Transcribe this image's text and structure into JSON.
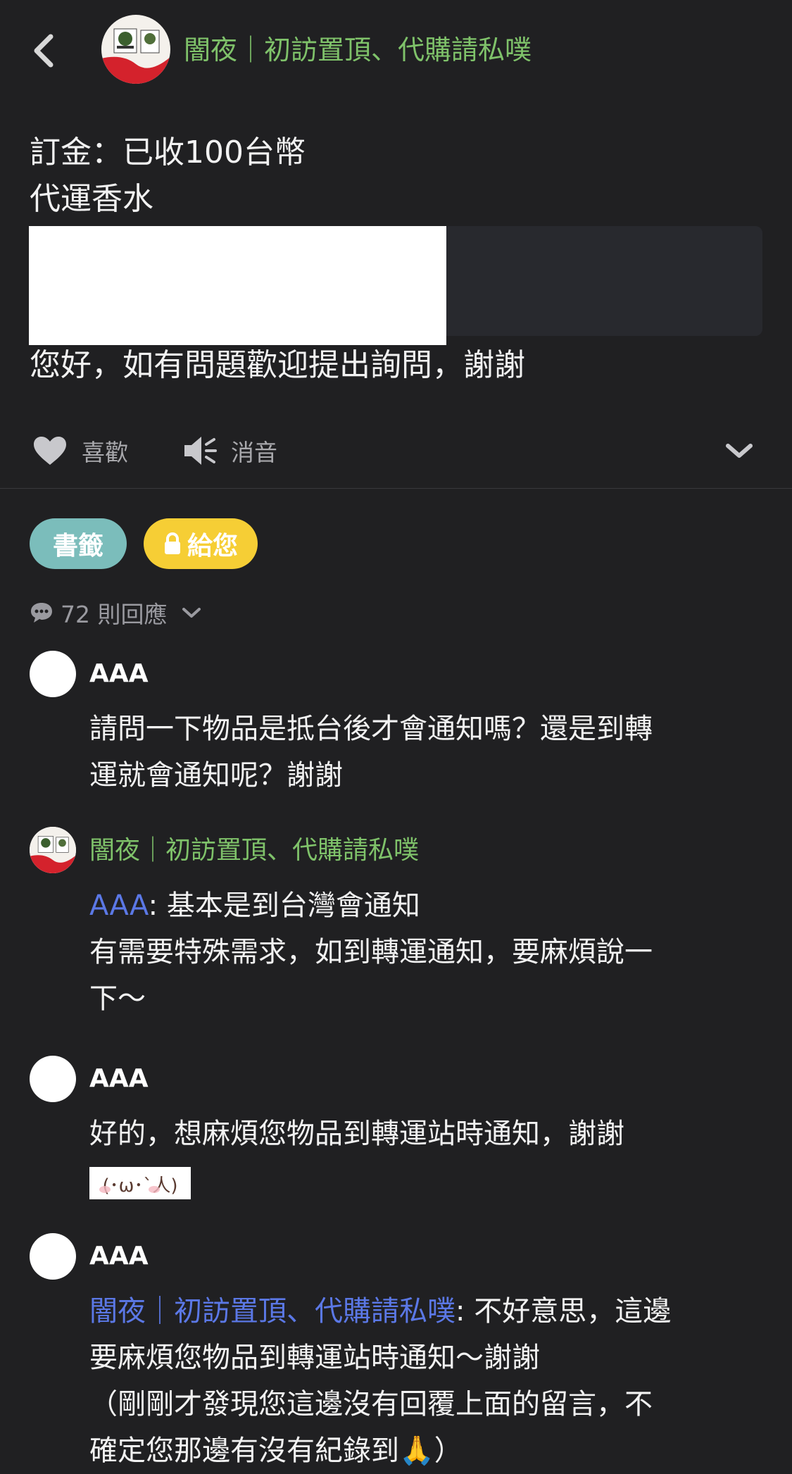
{
  "header": {
    "back_icon": "chevron-left-icon",
    "title": "闇夜｜初訪置頂、代購請私噗",
    "title_color": "#7fc26a"
  },
  "post": {
    "line1": "訂金：已收100台幣",
    "line2": "代運香水",
    "line3": "您好，如有問題歡迎提出詢問，謝謝"
  },
  "actions": {
    "like_icon": "heart-icon",
    "like_label": "喜歡",
    "mute_icon": "speaker-mute-icon",
    "mute_label": "消音",
    "expand_icon": "chevron-down-icon"
  },
  "tags": {
    "bookmark_label": "書籤",
    "bookmark_color": "#7bbdbb",
    "private_label": "給您",
    "private_icon": "lock-icon",
    "private_color": "#f6ce35"
  },
  "responses": {
    "icon": "speech-bubble-icon",
    "count_label": "72 則回應",
    "toggle_icon": "chevron-down-icon"
  },
  "comments": [
    {
      "name": "AAA",
      "lines": [
        "請問一下物品是抵台後才會通知嗎？還是到轉",
        "運就會通知呢？謝謝"
      ]
    },
    {
      "name": "闇夜｜初訪置頂、代購請私噗",
      "mention": "AAA",
      "lines": [
        ": 基本是到台灣會通知",
        "有需要特殊需求，如到轉運通知，要麻煩說一",
        "下～"
      ]
    },
    {
      "name": "AAA",
      "lines": [
        "好的，想麻煩您物品到轉運站時通知，謝謝"
      ],
      "emoticon": "(･ω･`人)"
    },
    {
      "name": "AAA",
      "mention": "闇夜｜初訪置頂、代購請私噗",
      "lines": [
        ": 不好意思，這邊",
        "要麻煩您物品到轉運站時通知～謝謝",
        "（剛剛才發現您這邊沒有回覆上面的留言，不",
        "確定您那邊有沒有紀錄到🙏）"
      ]
    }
  ],
  "colors": {
    "background": "#202022",
    "mention": "#5b78e6"
  }
}
